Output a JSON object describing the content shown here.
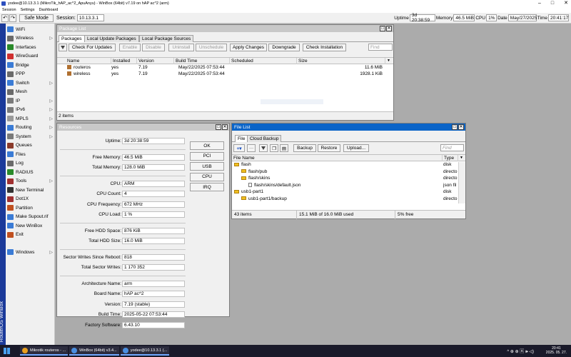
{
  "window": {
    "title": "yodee@10.13.3.1 (MikroTik_hAP_ac^2_ApuAnyu) - WinBox (64bit) v7.19 on hAP ac^2 (arm)",
    "minimize": "–",
    "maximize": "□",
    "close": "✕"
  },
  "menu": [
    "Session",
    "Settings",
    "Dashboard"
  ],
  "toolbar": {
    "undo": "↶",
    "redo": "↷",
    "safe_mode": "Safe Mode",
    "session_label": "Session:",
    "session_value": "10.13.3.1",
    "uptime_label": "Uptime",
    "uptime": "3d 20:38:59",
    "memory_label": "Memory",
    "memory": "46.5 MiB",
    "cpu_label": "CPU",
    "cpu": "1%",
    "date_label": "Date",
    "date": "May/27/2025",
    "time_label": "Time",
    "time": "20:41:17"
  },
  "sidebar": {
    "brand": "RouterOS WinBox",
    "items": [
      {
        "label": "WiFi",
        "icon": "wifi-icon",
        "sub": false
      },
      {
        "label": "Wireless",
        "icon": "wireless-icon",
        "sub": true
      },
      {
        "label": "Interfaces",
        "icon": "interfaces-icon",
        "sub": false
      },
      {
        "label": "WireGuard",
        "icon": "wireguard-icon",
        "sub": false
      },
      {
        "label": "Bridge",
        "icon": "bridge-icon",
        "sub": false
      },
      {
        "label": "PPP",
        "icon": "ppp-icon",
        "sub": false
      },
      {
        "label": "Switch",
        "icon": "switch-icon",
        "sub": true
      },
      {
        "label": "Mesh",
        "icon": "mesh-icon",
        "sub": false
      },
      {
        "label": "IP",
        "icon": "ip-icon",
        "sub": true
      },
      {
        "label": "IPv6",
        "icon": "ipv6-icon",
        "sub": true
      },
      {
        "label": "MPLS",
        "icon": "mpls-icon",
        "sub": true
      },
      {
        "label": "Routing",
        "icon": "routing-icon",
        "sub": true
      },
      {
        "label": "System",
        "icon": "system-icon",
        "sub": true
      },
      {
        "label": "Queues",
        "icon": "queues-icon",
        "sub": false
      },
      {
        "label": "Files",
        "icon": "files-icon",
        "sub": false
      },
      {
        "label": "Log",
        "icon": "log-icon",
        "sub": false
      },
      {
        "label": "RADIUS",
        "icon": "radius-icon",
        "sub": false
      },
      {
        "label": "Tools",
        "icon": "tools-icon",
        "sub": true
      },
      {
        "label": "New Terminal",
        "icon": "terminal-icon",
        "sub": false
      },
      {
        "label": "Dot1X",
        "icon": "dot1x-icon",
        "sub": false
      },
      {
        "label": "Partition",
        "icon": "partition-icon",
        "sub": false
      },
      {
        "label": "Make Supout.rif",
        "icon": "supout-icon",
        "sub": false
      },
      {
        "label": "New WinBox",
        "icon": "winbox-icon",
        "sub": false
      },
      {
        "label": "Exit",
        "icon": "exit-icon",
        "sub": false
      }
    ],
    "windows_item": {
      "label": "Windows",
      "icon": "windows-icon"
    }
  },
  "package_list": {
    "title": "Package List",
    "tabs": [
      "Packages",
      "Local Update Packages",
      "Local Package Sources"
    ],
    "buttons": [
      "Check For Updates",
      "Enable",
      "Disable",
      "Uninstall",
      "Unschedule",
      "Apply Changes",
      "Downgrade",
      "Check Installation"
    ],
    "find_placeholder": "Find",
    "columns": [
      "Name",
      "Installed",
      "Version",
      "Build Time",
      "Scheduled",
      "Size"
    ],
    "rows": [
      {
        "name": "routeros",
        "installed": "yes",
        "version": "7.19",
        "build": "May/22/2025 07:53:44",
        "scheduled": "",
        "size": "11.6 MiB"
      },
      {
        "name": "wireless",
        "installed": "yes",
        "version": "7.19",
        "build": "May/22/2025 07:53:44",
        "scheduled": "",
        "size": "1928.1 KiB"
      }
    ],
    "status": "2 items"
  },
  "resources": {
    "title": "Resources",
    "groups": [
      [
        {
          "label": "Uptime:",
          "value": "3d 20:38:59"
        }
      ],
      [
        {
          "label": "Free Memory:",
          "value": "46.5 MiB"
        },
        {
          "label": "Total Memory:",
          "value": "128.0 MiB"
        }
      ],
      [
        {
          "label": "CPU:",
          "value": "ARM"
        },
        {
          "label": "CPU Count:",
          "value": "4"
        },
        {
          "label": "CPU Frequency:",
          "value": "672 MHz"
        },
        {
          "label": "CPU Load:",
          "value": "1 %"
        }
      ],
      [
        {
          "label": "Free HDD Space:",
          "value": "876 KiB"
        },
        {
          "label": "Total HDD Size:",
          "value": "16.0 MiB"
        }
      ],
      [
        {
          "label": "Sector Writes Since Reboot:",
          "value": "818"
        },
        {
          "label": "Total Sector Writes:",
          "value": "1 170 352"
        }
      ],
      [
        {
          "label": "Architecture Name:",
          "value": "arm"
        },
        {
          "label": "Board Name:",
          "value": "hAP ac^2"
        },
        {
          "label": "Version:",
          "value": "7.19 (stable)"
        },
        {
          "label": "Build Time:",
          "value": "2025-05-22 07:53:44"
        },
        {
          "label": "Factory Software:",
          "value": "6.43.10"
        }
      ]
    ],
    "buttons": [
      "OK",
      "PCI",
      "USB",
      "CPU",
      "IRQ"
    ]
  },
  "file_list": {
    "title": "File List",
    "tabs": [
      "File",
      "Cloud Backup"
    ],
    "buttons": [
      "Backup",
      "Restore",
      "Upload..."
    ],
    "find_placeholder": "Find",
    "columns": [
      "File Name",
      "Type"
    ],
    "rows": [
      {
        "name": "flash",
        "type": "disk",
        "indent": 0,
        "kind": "folder"
      },
      {
        "name": "flash/pub",
        "type": "directo",
        "indent": 1,
        "kind": "folder"
      },
      {
        "name": "flash/skins",
        "type": "directo",
        "indent": 1,
        "kind": "folder"
      },
      {
        "name": "flash/skins/default.json",
        "type": "json fil",
        "indent": 2,
        "kind": "file"
      },
      {
        "name": "usb1-part1",
        "type": "disk",
        "indent": 0,
        "kind": "folder"
      },
      {
        "name": "usb1-part1/backup",
        "type": "directo",
        "indent": 1,
        "kind": "folder"
      }
    ],
    "status_items": "43 items",
    "status_used": "15.1 MiB of 16.0 MiB used",
    "status_free": "5% free"
  },
  "taskbar": {
    "tasks": [
      {
        "label": "Mikrotik routeros - ...",
        "color": "#e8a020"
      },
      {
        "label": "WinBox (64bit) v3.4...",
        "color": "#4a8fe0"
      },
      {
        "label": "yodee@10.13.3.1 (...",
        "color": "#4a8fe0"
      }
    ],
    "tray": "^ ⊕ ⊕ 🄰 🕪 ◁)",
    "clock_time": "20:41",
    "clock_date": "2025. 05. 27."
  }
}
